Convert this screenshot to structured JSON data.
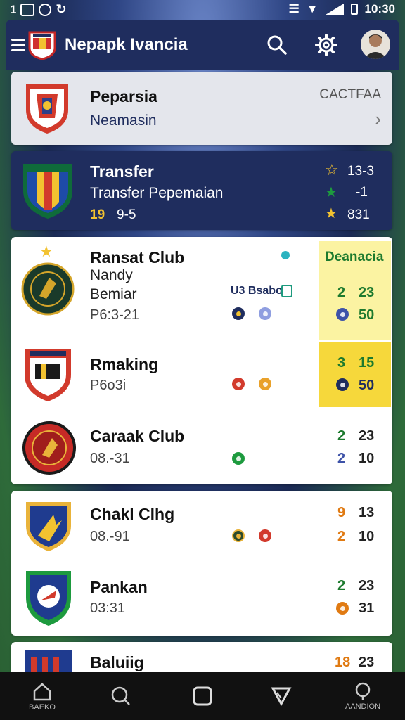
{
  "status_bar": {
    "left_label": "1",
    "time": "10:30"
  },
  "app_bar": {
    "title": "Nepapk Ivancia"
  },
  "feature_card": {
    "title": "Peparsia",
    "subtitle": "Neamasin",
    "right_label": "CACTFAA"
  },
  "transfer_card": {
    "title": "Transfer",
    "subtitle": "Transfer Pepemaian",
    "meta_a": "19",
    "meta_b": "9-5",
    "stat1": "13-3",
    "stat2": "-1",
    "stat3": "831"
  },
  "list_group_1": {
    "highlight_header": "Deanacia",
    "rows": [
      {
        "name": "Ransat Club",
        "line2": "Nandy",
        "line3": "Bemiar",
        "meta": "P6:3-21",
        "badge": "U3 Bsabo",
        "v1": "2",
        "v2": "23",
        "v3": "50"
      },
      {
        "name": "Rmaking",
        "meta": "P6o3i",
        "v1": "3",
        "v2": "15",
        "v3": "50"
      },
      {
        "name": "Caraak Club",
        "meta": "08.-31",
        "v1": "2",
        "v2": "23",
        "v3": "2",
        "v4": "10"
      }
    ]
  },
  "list_group_2": {
    "rows": [
      {
        "name": "Chakl Clhg",
        "meta": "08.-91",
        "v1": "9",
        "v2": "13",
        "v3": "2",
        "v4": "10"
      },
      {
        "name": "Pankan",
        "meta": "03:31",
        "v1": "2",
        "v2": "23",
        "v4": "31"
      }
    ]
  },
  "list_group_3": {
    "rows": [
      {
        "name": "Baluiig",
        "v1": "18",
        "v2": "23"
      }
    ]
  },
  "bottom_nav": {
    "items": [
      {
        "label": "BAEKO",
        "icon": "home-icon"
      },
      {
        "label": "",
        "icon": "search-icon"
      },
      {
        "label": "",
        "icon": "square-icon"
      },
      {
        "label": "",
        "icon": "back-triangle-icon"
      },
      {
        "label": "AANDION",
        "icon": "profile-icon"
      }
    ]
  },
  "colors": {
    "navy": "#1f2d5e",
    "highlight_light": "#fbf3a2",
    "highlight_strong": "#f6d83b",
    "green_number": "#1d7a2e",
    "orange_number": "#e07a12",
    "blue_number": "#3d52a8"
  }
}
